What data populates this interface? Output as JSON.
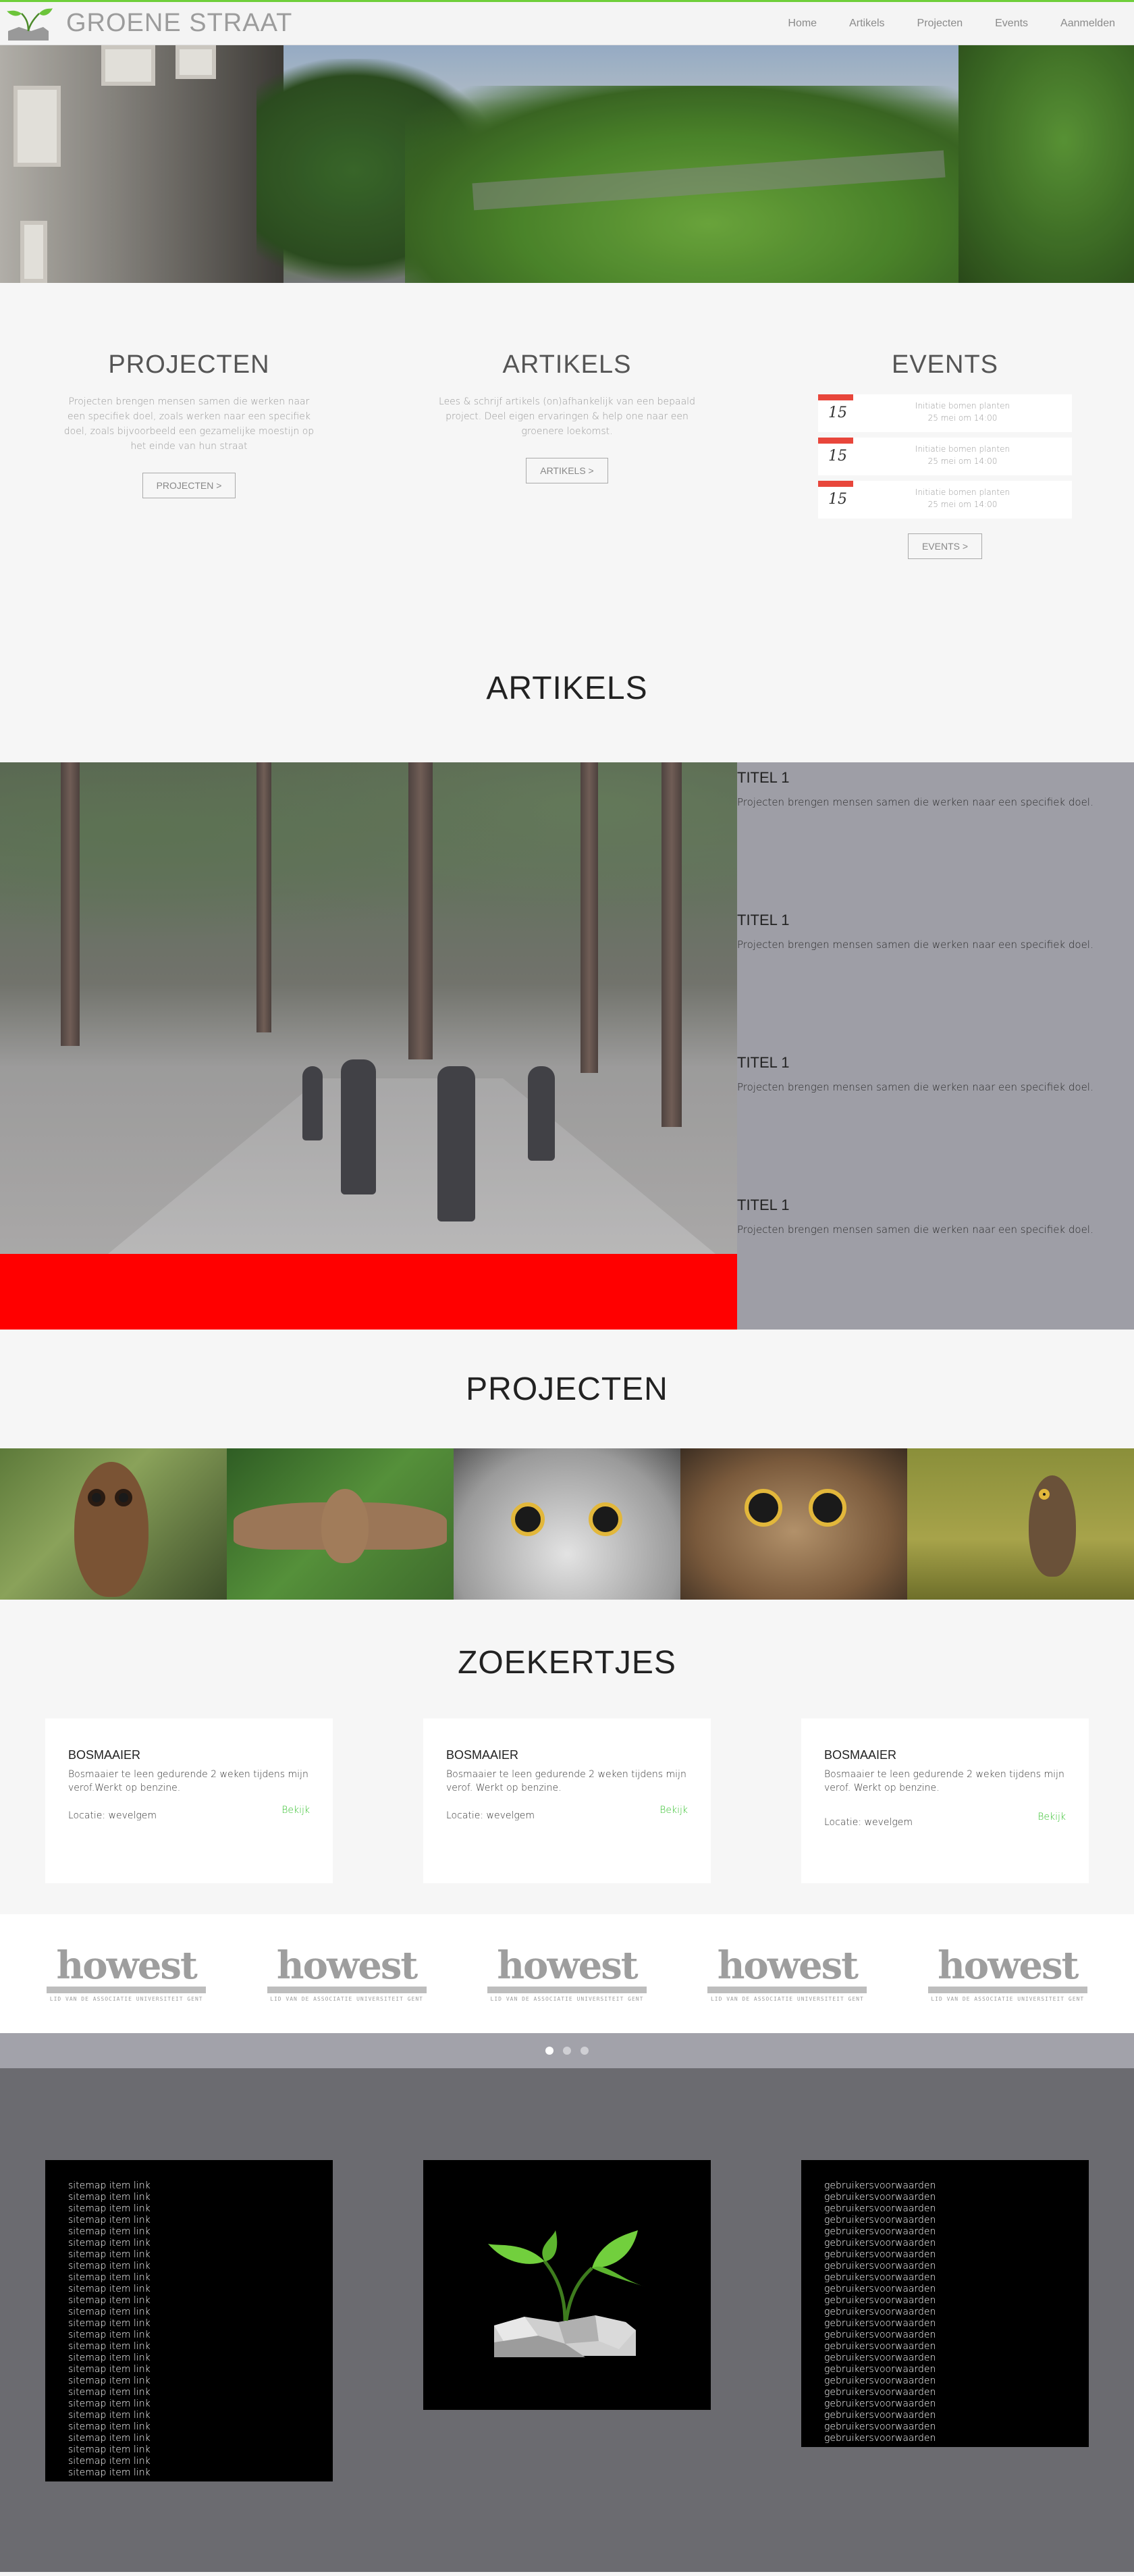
{
  "nav": {
    "brand": "GROENE STRAAT",
    "items": [
      "Home",
      "Artikels",
      "Projecten",
      "Events",
      "Aanmelden"
    ]
  },
  "intro": {
    "projecten": {
      "title": "PROJECTEN",
      "text": "Projecten brengen mensen samen die werken naar een specifiek doel, zoals werken naar een specifiek doel, zoals bijvoorbeeld een gezamelijke moestijn op het einde van hun straat",
      "button": "PROJECTEN >"
    },
    "artikels": {
      "title": "ARTIKELS",
      "text": "Lees & schrijf artikels (on)afhankelijk van een bepaald project. Deel eigen ervaringen & help one naar een groenere loekomst.",
      "button": "ARTIKELS >"
    },
    "events": {
      "title": "EVENTS",
      "items": [
        {
          "day": "15",
          "name": "Initiatie bomen planten",
          "when": "25 mei om 14:00"
        },
        {
          "day": "15",
          "name": "Initiatie bomen planten",
          "when": "25 mei om 14:00"
        },
        {
          "day": "15",
          "name": "Initiatie bomen planten",
          "when": "25 mei om 14:00"
        }
      ],
      "button": "EVENTS >"
    }
  },
  "artikels": {
    "title": "ARTIKELS",
    "items": [
      {
        "title": "TITEL 1",
        "text": "Projecten brengen mensen samen die werken naar een specifiek doel."
      },
      {
        "title": "TITEL 1",
        "text": "Projecten brengen mensen samen die werken naar een specifiek doel."
      },
      {
        "title": "TITEL 1",
        "text": "Projecten brengen mensen samen die werken naar een specifiek doel."
      },
      {
        "title": "TITEL 1",
        "text": "Projecten brengen mensen samen die werken naar een specifiek doel."
      }
    ]
  },
  "projecten": {
    "title": "PROJECTEN"
  },
  "zoekertjes": {
    "title": "ZOEKERTJES",
    "ads": [
      {
        "title": "BOSMAAIER",
        "text": "Bosmaaier te leen gedurende 2 weken tijdens mijn verof.Werkt op benzine.",
        "location": "Locatie: wevelgem",
        "link": "Bekijk"
      },
      {
        "title": "BOSMAAIER",
        "text": "Bosmaaier te leen gedurende 2 weken tijdens mijn verof. Werkt op benzine.",
        "location": "Locatie: wevelgem",
        "link": "Bekijk"
      },
      {
        "title": "BOSMAAIER",
        "text": "Bosmaaier te leen gedurende 2 weken tijdens mijn verof. Werkt op benzine.",
        "location": "Locatie: wevelgem",
        "link": "Bekijk"
      }
    ]
  },
  "sponsors": {
    "logos": [
      {
        "name": "howest",
        "sub": "de hogeschool west-vlaanderen",
        "tag": "LID VAN DE ASSOCIATIE UNIVERSITEIT GENT"
      },
      {
        "name": "howest",
        "sub": "de hogeschool west-vlaanderen",
        "tag": "LID VAN DE ASSOCIATIE UNIVERSITEIT GENT"
      },
      {
        "name": "howest",
        "sub": "de hogeschool west-vlaanderen",
        "tag": "LID VAN DE ASSOCIATIE UNIVERSITEIT GENT"
      },
      {
        "name": "howest",
        "sub": "de hogeschool west-vlaanderen",
        "tag": "LID VAN DE ASSOCIATIE UNIVERSITEIT GENT"
      },
      {
        "name": "howest",
        "sub": "de hogeschool west-vlaanderen",
        "tag": "LID VAN DE ASSOCIATIE UNIVERSITEIT GENT"
      }
    ],
    "active_dot": 1,
    "dot_count": 3
  },
  "footer": {
    "sitemap_label": "sitemap item link",
    "sitemap_count": 26,
    "terms_label": "gebruikersvoorwaarden",
    "terms_count": 23
  },
  "colors": {
    "accent_green": "#6fcf3a",
    "link_green": "#37c12f",
    "red_bar": "#ff0000",
    "article_panel": "#9e9ea6",
    "footer_bg": "#6b6b70"
  }
}
